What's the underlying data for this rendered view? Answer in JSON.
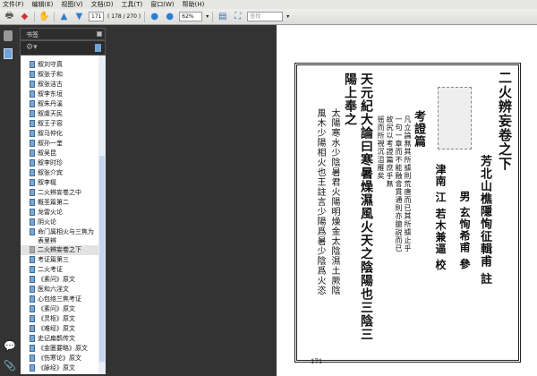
{
  "menu": [
    "文件(F)",
    "编辑(E)",
    "视图(V)",
    "文档(D)",
    "工具(T)",
    "窗口(W)",
    "帮助(H)"
  ],
  "toolbar": {
    "page_input": "171",
    "page_count": "( 178 / 270 )",
    "zoom": "62%",
    "search_placeholder": "查找"
  },
  "panel": {
    "title": "书签"
  },
  "bookmarks": [
    "叙刘守真",
    "叙张子和",
    "叙张洁古",
    "叙李东垣",
    "叙朱丹溪",
    "叙虞天民",
    "叙王子容",
    "叙马仲化",
    "叙孙一奎",
    "叙吴昆",
    "叙李时珍",
    "叙张介宾",
    "叙李梴",
    "二火辨妄卷之中",
    "概圣篇第二",
    "龙雷火论",
    "阴火论",
    "命门属相火与三焦为表里辨",
    "二火辨妄卷之下",
    "考证篇第三",
    "二火考证",
    "《素问》原文",
    "医和六淫文",
    "心包络三焦考证",
    "《素问》原文",
    "《灵枢》原文",
    "《难经》原文",
    "史记扁鹊传文",
    "《金匮要略》原文",
    "《伤寒论》原文",
    "《脉经》原文"
  ],
  "selected_bookmark": "二火辨妄卷之下",
  "document": {
    "title": "二火辨妄卷之下",
    "author": "芳北山樵隱恂征輯甫 註",
    "son": "男 玄恂希甫 參",
    "proof": "津南 江 若木兼逼 校",
    "section": "考證篇",
    "intro1": "凡立論無其所據則荒唐而已其所據止乎",
    "intro2": "一句一章而不能融會貫通則亦臆説而已",
    "intro3": "故尻以考證篇庶乎無",
    "intro4": "徭而所視沉沮雁矣",
    "quote": "天元紀大論曰寒暑燥濕風火天之陰陽也三陰三",
    "quote2": "陽上奉之",
    "note1": "太陽寒水少陰暑君火陽明燥金太陰濕土厥陰",
    "note2": "風木少陽相火也王註言少陽爲暑少陰爲火恣",
    "page_number": "171"
  }
}
